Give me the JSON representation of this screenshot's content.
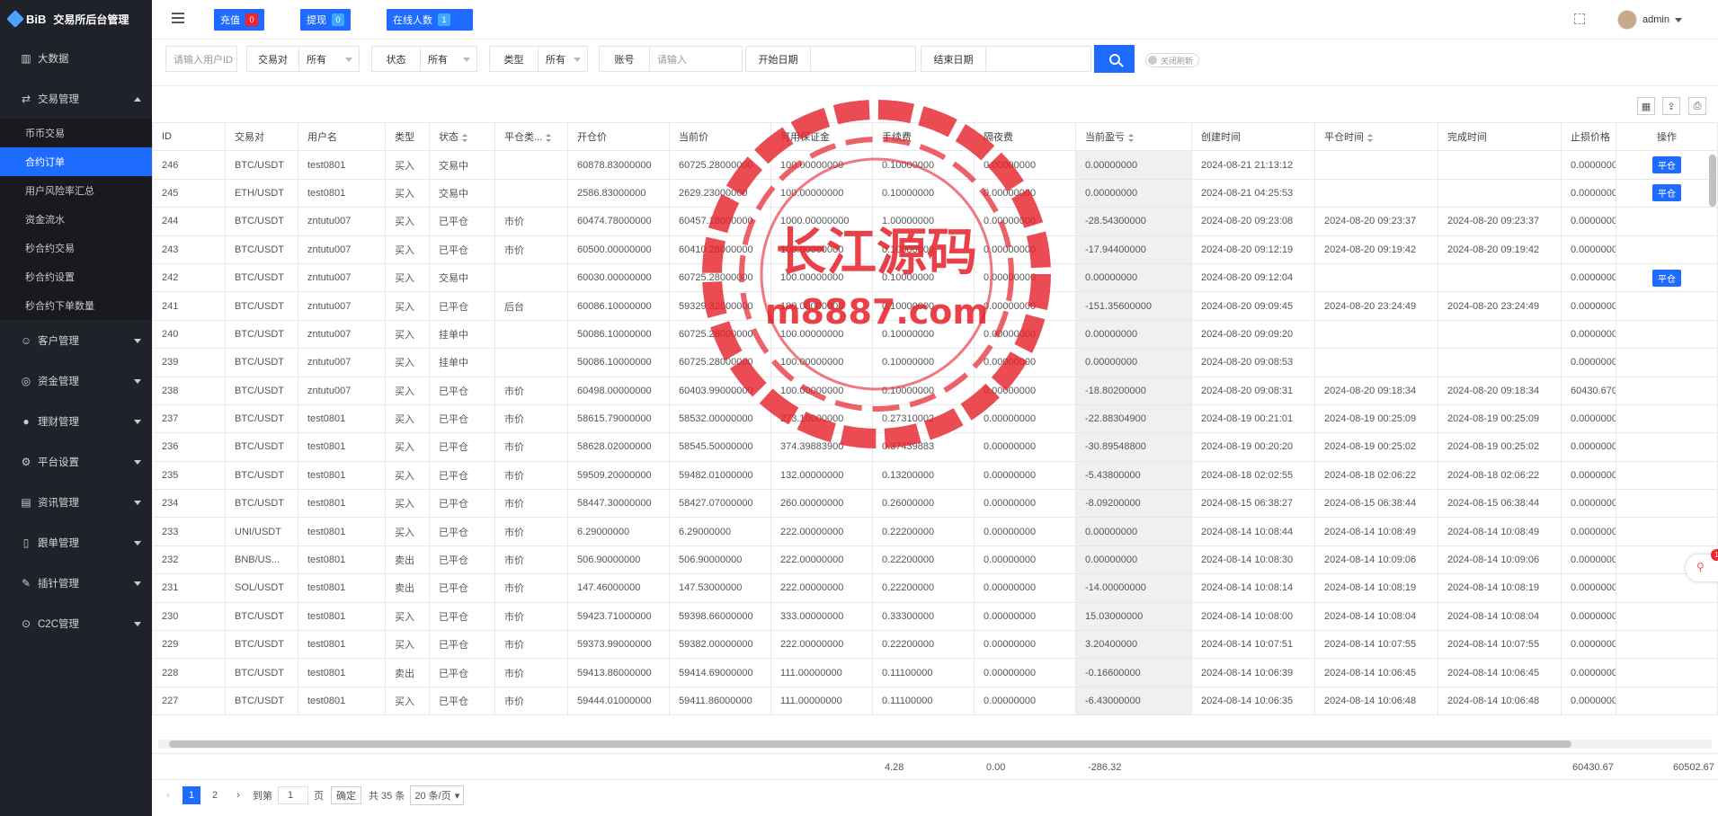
{
  "app": {
    "brand": "BiB",
    "title": "交易所后台管理"
  },
  "sidebar": {
    "top_item": "大数据",
    "trade_menu": "交易管理",
    "sub_items": [
      "币币交易",
      "合约订单",
      "用户风险率汇总",
      "资金流水",
      "秒合约交易",
      "秒合约设置",
      "秒合约下单数量"
    ],
    "active_sub": "合约订单",
    "groups": [
      "客户管理",
      "资金管理",
      "理财管理",
      "平台设置",
      "资讯管理",
      "跟单管理",
      "插针管理",
      "C2C管理"
    ]
  },
  "topbar": {
    "recharge_label": "充值",
    "recharge_count": "0",
    "withdraw_label": "提现",
    "withdraw_count": "0",
    "online_label": "在线人数",
    "online_count": "1",
    "user_name": "admin"
  },
  "filters": {
    "user_id_placeholder": "请输入用户ID",
    "pair_label": "交易对",
    "pair_value": "所有",
    "status_label": "状态",
    "status_value": "所有",
    "type_label": "类型",
    "type_value": "所有",
    "account_label": "账号",
    "account_placeholder": "请输入",
    "start_label": "开始日期",
    "end_label": "结束日期",
    "refresh_toggle": "关闭刷新"
  },
  "table": {
    "headers": [
      "ID",
      "交易对",
      "用户名",
      "类型",
      "状态",
      "平仓类...",
      "开仓价",
      "当前价",
      "可用保证金",
      "手续费",
      "隔夜费",
      "当前盈亏",
      "创建时间",
      "平仓时间",
      "完成时间",
      "止损价格",
      "操作"
    ],
    "close_label": "平仓",
    "rows": [
      [
        "246",
        "BTC/USDT",
        "test0801",
        "买入",
        "交易中",
        "",
        "60878.83000000",
        "60725.28000000",
        "100.00000000",
        "0.10000000",
        "0.00000000",
        "0.00000000",
        "2024-08-21 21:13:12",
        "",
        "",
        "0.00000000",
        "平仓"
      ],
      [
        "245",
        "ETH/USDT",
        "test0801",
        "买入",
        "交易中",
        "",
        "2586.83000000",
        "2629.23000000",
        "100.00000000",
        "0.10000000",
        "0.00000000",
        "0.00000000",
        "2024-08-21 04:25:53",
        "",
        "",
        "0.00000000",
        "平仓"
      ],
      [
        "244",
        "BTC/USDT",
        "zntutu007",
        "买入",
        "已平仓",
        "市价",
        "60474.78000000",
        "60457.18000000",
        "1000.00000000",
        "1.00000000",
        "0.00000000",
        "-28.54300000",
        "2024-08-20 09:23:08",
        "2024-08-20 09:23:37",
        "2024-08-20 09:23:37",
        "0.00000000",
        ""
      ],
      [
        "243",
        "BTC/USDT",
        "zntutu007",
        "买入",
        "已平仓",
        "市价",
        "60500.00000000",
        "60410.28000000",
        "100.00000000",
        "0.10000000",
        "0.00000000",
        "-17.94400000",
        "2024-08-20 09:12:19",
        "2024-08-20 09:19:42",
        "2024-08-20 09:19:42",
        "0.00000000",
        ""
      ],
      [
        "242",
        "BTC/USDT",
        "zntutu007",
        "买入",
        "交易中",
        "",
        "60030.00000000",
        "60725.28000000",
        "100.00000000",
        "0.10000000",
        "0.00000000",
        "0.00000000",
        "2024-08-20 09:12:04",
        "",
        "",
        "0.00000000",
        "平仓"
      ],
      [
        "241",
        "BTC/USDT",
        "zntutu007",
        "买入",
        "已平仓",
        "后台",
        "60086.10000000",
        "59329.32000000",
        "100.00000000",
        "0.10000000",
        "0.00000000",
        "-151.35600000",
        "2024-08-20 09:09:45",
        "2024-08-20 23:24:49",
        "2024-08-20 23:24:49",
        "0.00000000",
        ""
      ],
      [
        "240",
        "BTC/USDT",
        "zntutu007",
        "买入",
        "挂单中",
        "",
        "50086.10000000",
        "60725.28000000",
        "100.00000000",
        "0.10000000",
        "0.00000000",
        "0.00000000",
        "2024-08-20 09:09:20",
        "",
        "",
        "0.00000000",
        ""
      ],
      [
        "239",
        "BTC/USDT",
        "zntutu007",
        "买入",
        "挂单中",
        "",
        "50086.10000000",
        "60725.28000000",
        "100.00000000",
        "0.10000000",
        "0.00000000",
        "0.00000000",
        "2024-08-20 09:08:53",
        "",
        "",
        "0.00000000",
        ""
      ],
      [
        "238",
        "BTC/USDT",
        "zntutu007",
        "买入",
        "已平仓",
        "市价",
        "60498.00000000",
        "60403.99000000",
        "100.00000000",
        "0.10000000",
        "0.00000000",
        "-18.80200000",
        "2024-08-20 09:08:31",
        "2024-08-20 09:18:34",
        "2024-08-20 09:18:34",
        "60430.67000000",
        ""
      ],
      [
        "237",
        "BTC/USDT",
        "test0801",
        "买入",
        "已平仓",
        "市价",
        "58615.79000000",
        "58532.00000000",
        "273.10000000",
        "0.27310002",
        "0.00000000",
        "-22.88304900",
        "2024-08-19 00:21:01",
        "2024-08-19 00:25:09",
        "2024-08-19 00:25:09",
        "0.00000000",
        ""
      ],
      [
        "236",
        "BTC/USDT",
        "test0801",
        "买入",
        "已平仓",
        "市价",
        "58628.02000000",
        "58545.50000000",
        "374.39883900",
        "0.37439883",
        "0.00000000",
        "-30.89548800",
        "2024-08-19 00:20:20",
        "2024-08-19 00:25:02",
        "2024-08-19 00:25:02",
        "0.00000000",
        ""
      ],
      [
        "235",
        "BTC/USDT",
        "test0801",
        "买入",
        "已平仓",
        "市价",
        "59509.20000000",
        "59482.01000000",
        "132.00000000",
        "0.13200000",
        "0.00000000",
        "-5.43800000",
        "2024-08-18 02:02:55",
        "2024-08-18 02:06:22",
        "2024-08-18 02:06:22",
        "0.00000000",
        ""
      ],
      [
        "234",
        "BTC/USDT",
        "test0801",
        "买入",
        "已平仓",
        "市价",
        "58447.30000000",
        "58427.07000000",
        "260.00000000",
        "0.26000000",
        "0.00000000",
        "-8.09200000",
        "2024-08-15 06:38:27",
        "2024-08-15 06:38:44",
        "2024-08-15 06:38:44",
        "0.00000000",
        ""
      ],
      [
        "233",
        "UNI/USDT",
        "test0801",
        "买入",
        "已平仓",
        "市价",
        "6.29000000",
        "6.29000000",
        "222.00000000",
        "0.22200000",
        "0.00000000",
        "0.00000000",
        "2024-08-14 10:08:44",
        "2024-08-14 10:08:49",
        "2024-08-14 10:08:49",
        "0.00000000",
        ""
      ],
      [
        "232",
        "BNB/US...",
        "test0801",
        "卖出",
        "已平仓",
        "市价",
        "506.90000000",
        "506.90000000",
        "222.00000000",
        "0.22200000",
        "0.00000000",
        "0.00000000",
        "2024-08-14 10:08:30",
        "2024-08-14 10:09:06",
        "2024-08-14 10:09:06",
        "0.00000000",
        ""
      ],
      [
        "231",
        "SOL/USDT",
        "test0801",
        "卖出",
        "已平仓",
        "市价",
        "147.46000000",
        "147.53000000",
        "222.00000000",
        "0.22200000",
        "0.00000000",
        "-14.00000000",
        "2024-08-14 10:08:14",
        "2024-08-14 10:08:19",
        "2024-08-14 10:08:19",
        "0.00000000",
        ""
      ],
      [
        "230",
        "BTC/USDT",
        "test0801",
        "买入",
        "已平仓",
        "市价",
        "59423.71000000",
        "59398.66000000",
        "333.00000000",
        "0.33300000",
        "0.00000000",
        "15.03000000",
        "2024-08-14 10:08:00",
        "2024-08-14 10:08:04",
        "2024-08-14 10:08:04",
        "0.00000000",
        ""
      ],
      [
        "229",
        "BTC/USDT",
        "test0801",
        "买入",
        "已平仓",
        "市价",
        "59373.99000000",
        "59382.00000000",
        "222.00000000",
        "0.22200000",
        "0.00000000",
        "3.20400000",
        "2024-08-14 10:07:51",
        "2024-08-14 10:07:55",
        "2024-08-14 10:07:55",
        "0.00000000",
        ""
      ],
      [
        "228",
        "BTC/USDT",
        "test0801",
        "卖出",
        "已平仓",
        "市价",
        "59413.86000000",
        "59414.69000000",
        "111.00000000",
        "0.11100000",
        "0.00000000",
        "-0.16600000",
        "2024-08-14 10:06:39",
        "2024-08-14 10:06:45",
        "2024-08-14 10:06:45",
        "0.00000000",
        ""
      ],
      [
        "227",
        "BTC/USDT",
        "test0801",
        "买入",
        "已平仓",
        "市价",
        "59444.01000000",
        "59411.86000000",
        "111.00000000",
        "0.11100000",
        "0.00000000",
        "-6.43000000",
        "2024-08-14 10:06:35",
        "2024-08-14 10:06:48",
        "2024-08-14 10:06:48",
        "0.00000000",
        ""
      ]
    ]
  },
  "totals": {
    "fee": "4.28",
    "overnight": "0.00",
    "pnl": "-286.32",
    "stop_loss": "60430.67",
    "stop_profit": "60502.67"
  },
  "pagination": {
    "page1": "1",
    "page2": "2",
    "goto_label": "到第",
    "goto_value": "1",
    "page_unit": "页",
    "confirm_label": "确定",
    "total_text": "共 35 条",
    "page_size": "20 条/页"
  },
  "watermark": {
    "line1": "长江源码",
    "line2": "m8887.com"
  },
  "float_badge": "1"
}
